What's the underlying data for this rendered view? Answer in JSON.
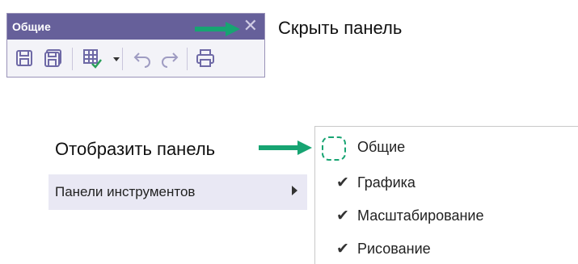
{
  "panel": {
    "title": "Общие",
    "close_glyph": "✕",
    "tools": [
      {
        "icon": "save-icon"
      },
      {
        "icon": "save-all-icon"
      },
      {
        "icon": "table-check-icon"
      },
      {
        "icon": "dropdown-arrow-icon"
      },
      {
        "icon": "undo-icon"
      },
      {
        "icon": "redo-icon"
      },
      {
        "icon": "print-icon"
      }
    ]
  },
  "annotations": {
    "hide_panel": "Скрыть панель",
    "show_panel": "Отобразить панель"
  },
  "menu": {
    "item_label": "Панели инструментов"
  },
  "submenu": {
    "items": [
      {
        "label": "Общие",
        "checked": false
      },
      {
        "label": "Графика",
        "checked": true
      },
      {
        "label": "Масштабирование",
        "checked": true
      },
      {
        "label": "Рисование",
        "checked": true
      }
    ],
    "check_glyph": "✔"
  },
  "colors": {
    "panel_header": "#66609a",
    "arrow": "#17a472",
    "menu_highlight": "#e9e8f4",
    "tool_icon": "#6e69a6"
  }
}
